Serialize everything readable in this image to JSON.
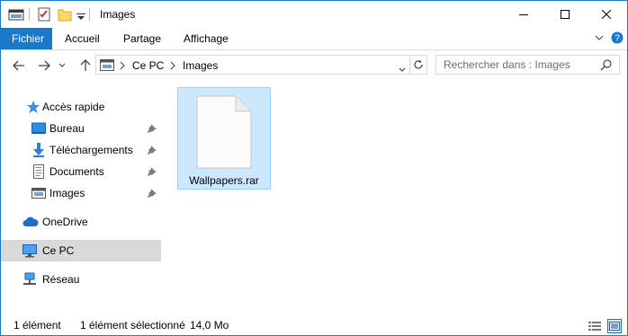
{
  "window": {
    "title": "Images"
  },
  "ribbon": {
    "tabs": [
      {
        "label": "Fichier"
      },
      {
        "label": "Accueil"
      },
      {
        "label": "Partage"
      },
      {
        "label": "Affichage"
      }
    ]
  },
  "address": {
    "crumbs": [
      "Ce PC",
      "Images"
    ]
  },
  "search": {
    "placeholder": "Rechercher dans : Images"
  },
  "nav": {
    "quick_access": "Accès rapide",
    "pinned": [
      "Bureau",
      "Téléchargements",
      "Documents",
      "Images"
    ],
    "onedrive": "OneDrive",
    "this_pc": "Ce PC",
    "network": "Réseau"
  },
  "content": {
    "files": [
      {
        "name": "Wallpapers.rar",
        "icon": "archive-file-icon"
      }
    ]
  },
  "statusbar": {
    "count": "1 élément",
    "selection": "1 élément sélectionné",
    "size": "14,0 Mo"
  },
  "colors": {
    "accent": "#1979ca",
    "selection": "#cce8ff",
    "nav_selected": "#d9d9d9"
  }
}
